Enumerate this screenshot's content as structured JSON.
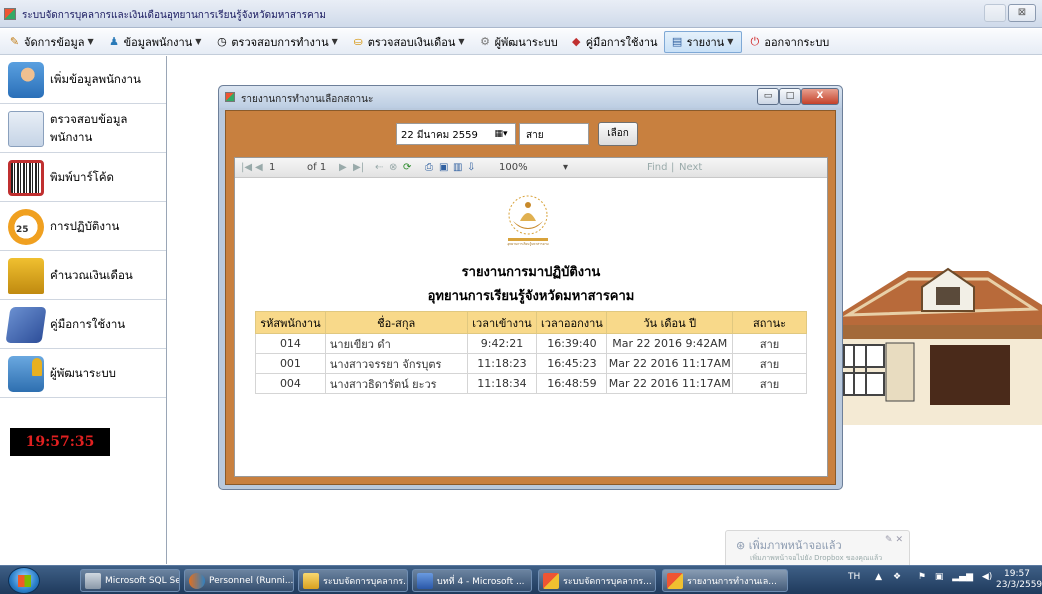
{
  "app": {
    "title": "ระบบจัดการบุคลากรและเงินเดือนอุทยานการเรียนรู้จังหวัดมหาสารคาม",
    "close_label": "⊠"
  },
  "menu": {
    "items": [
      {
        "label": "จัดการข้อมูล",
        "icon": "edit-icon"
      },
      {
        "label": "ข้อมูลพนักงาน",
        "icon": "people-icon"
      },
      {
        "label": "ตรวจสอบการทำงาน",
        "icon": "clock-icon"
      },
      {
        "label": "ตรวจสอบเงินเดือน",
        "icon": "money-icon"
      },
      {
        "label": "ผู้พัฒนาระบบ",
        "icon": "developer-icon"
      },
      {
        "label": "คู่มือการใช้งาน",
        "icon": "manual-icon"
      },
      {
        "label": "รายงาน",
        "icon": "report-icon"
      },
      {
        "label": "ออกจากระบบ",
        "icon": "exit-icon"
      }
    ]
  },
  "sidebar": {
    "items": [
      {
        "label": "เพิ่มข้อมูลพนักงาน"
      },
      {
        "label": "ตรวจสอบข้อมูลพนักงาน"
      },
      {
        "label": "พิมพ์บาร์โค้ด"
      },
      {
        "label": "การปฏิบัติงาน",
        "badge": "25"
      },
      {
        "label": "คำนวณเงินเดือน"
      },
      {
        "label": "คู่มือการใช้งาน"
      },
      {
        "label": "ผู้พัฒนาระบบ"
      }
    ],
    "clock": "19:57:35"
  },
  "report_window": {
    "title": "รายงานการทำงานเลือกสถานะ",
    "close_label": "X",
    "date_value": "22  มีนาคม   2559",
    "date_btn": "▦▾",
    "status_value": "สาย",
    "select_label": "เลือก",
    "toolbar": {
      "first": "|◀",
      "prev": "◀",
      "page": "1",
      "of": "of 1",
      "next": "▶",
      "last": "▶|",
      "zoom": "100%",
      "zoom_caret": "▾",
      "find": "Find",
      "sep": "|",
      "next_find": "Next"
    },
    "report": {
      "logo_caption": "อุทยานการเรียนรู้มหาสารคาม",
      "title": "รายงานการมาปฏิบัติงาน",
      "subtitle": "อุทยานการเรียนรู้จังหวัดมหาสารคาม",
      "columns": [
        "รหัสพนักงาน",
        "ชื่อ-สกุล",
        "เวลาเข้างาน",
        "เวลาออกงาน",
        "วัน เดือน ปี",
        "สถานะ"
      ],
      "rows": [
        [
          "014",
          "นายเขียว ดำ",
          "9:42:21",
          "16:39:40",
          "Mar 22 2016  9:42AM",
          "สาย"
        ],
        [
          "001",
          "นางสาวจรรยา จักรบุตร",
          "11:18:23",
          "16:45:23",
          "Mar 22 2016 11:17AM",
          "สาย"
        ],
        [
          "004",
          "นางสาวธิดารัตน์ ยะวร",
          "11:18:34",
          "16:48:59",
          "Mar 22 2016 11:17AM",
          "สาย"
        ]
      ]
    }
  },
  "toast": {
    "title": "⊛  เพิ่มภาพหน้าจอแล้ว",
    "sub": "เพิ่มภาพหน้าจอไปยัง Dropbox ของคุณแล้ว",
    "close": "✎  ✕"
  },
  "taskbar": {
    "tasks": [
      {
        "label": "Microsoft SQL Ser..."
      },
      {
        "label": "Personnel (Runni..."
      },
      {
        "label": "ระบบจัดการบุคลากร..."
      },
      {
        "label": "บทที่ 4 - Microsoft ..."
      },
      {
        "label": "ระบบจัดการบุคลากร..."
      },
      {
        "label": "รายงานการทำงานเล..."
      }
    ],
    "lang": "TH",
    "time": "19:57",
    "date": "23/3/2559"
  },
  "colors": {
    "report_bg": "#c8803f",
    "header_fill": "#f8d98a",
    "clock_text": "#e02020"
  }
}
